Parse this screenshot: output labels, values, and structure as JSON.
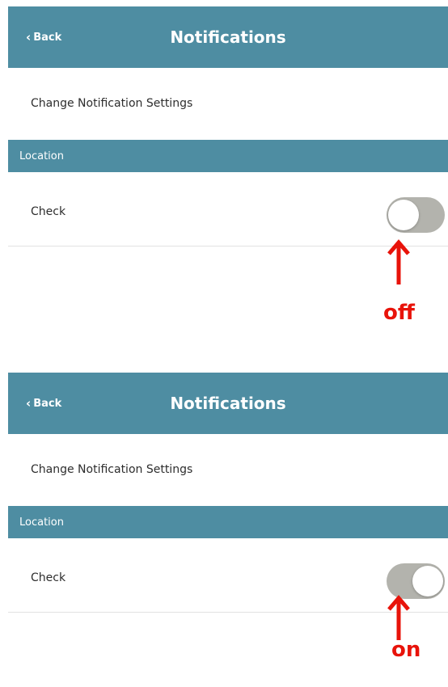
{
  "screens": [
    {
      "nav": {
        "back_label": "Back",
        "title": "Notifications"
      },
      "subtitle": "Change Notification Settings",
      "section": "Location",
      "row": {
        "label": "Check",
        "toggle_state": "off"
      },
      "annotation": "off"
    },
    {
      "nav": {
        "back_label": "Back",
        "title": "Notifications"
      },
      "subtitle": "Change Notification Settings",
      "section": "Location",
      "row": {
        "label": "Check",
        "toggle_state": "on"
      },
      "annotation": "on"
    }
  ],
  "colors": {
    "header": "#4e8da2",
    "toggle_track": "#b3b3ad",
    "annotation": "#e8130a"
  },
  "icons": [
    "chevron-left-icon",
    "arrow-up-icon"
  ]
}
